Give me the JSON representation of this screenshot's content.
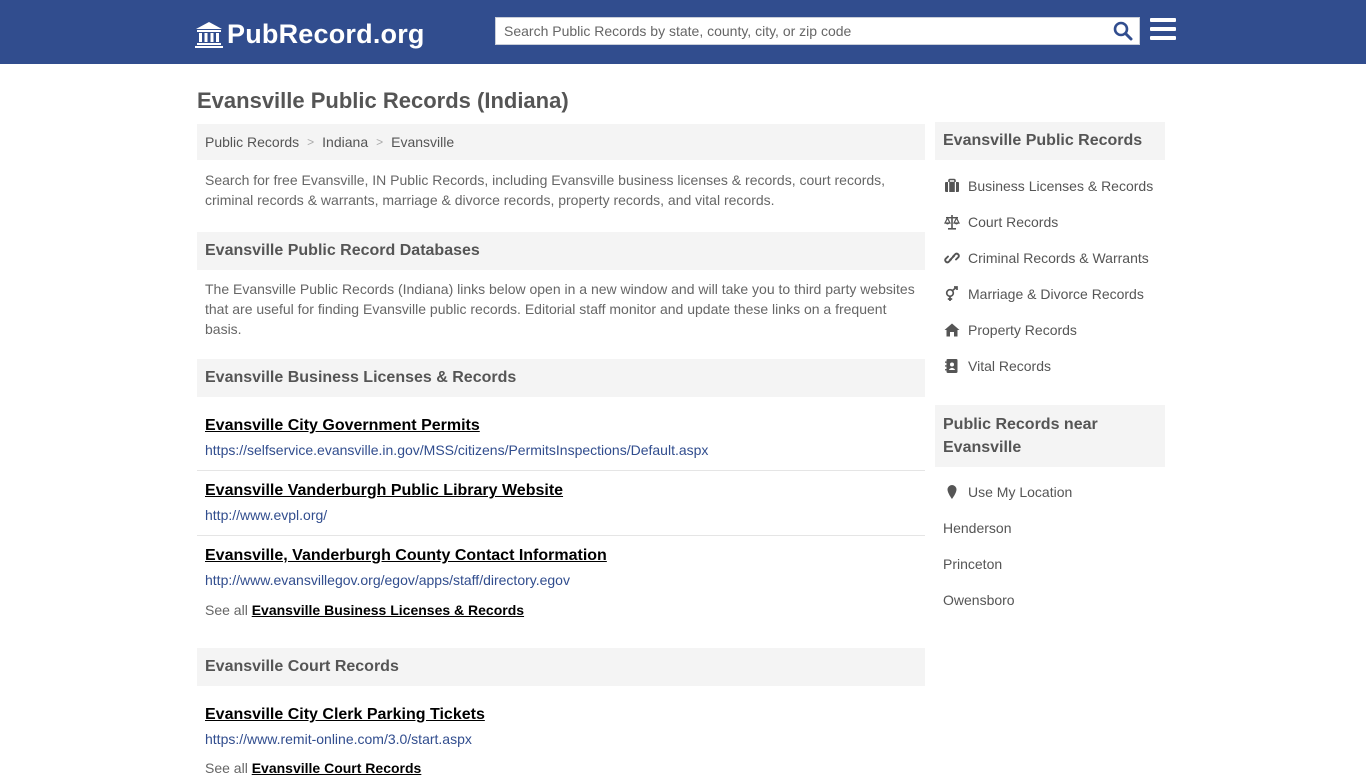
{
  "header": {
    "logo_text": "PubRecord.org",
    "search_placeholder": "Search Public Records by state, county, city, or zip code"
  },
  "page": {
    "title": "Evansville Public Records (Indiana)",
    "breadcrumb": [
      "Public Records",
      "Indiana",
      "Evansville"
    ],
    "intro": "Search for free Evansville, IN Public Records, including Evansville business licenses & records, court records, criminal records & warrants, marriage & divorce records, property records, and vital records."
  },
  "databases": {
    "heading": "Evansville Public Record Databases",
    "text": "The Evansville Public Records (Indiana) links below open in a new window and will take you to third party websites that are useful for finding Evansville public records. Editorial staff monitor and update these links on a frequent basis."
  },
  "business": {
    "heading": "Evansville Business Licenses & Records",
    "records": [
      {
        "title": "Evansville City Government Permits",
        "url": "https://selfservice.evansville.in.gov/MSS/citizens/PermitsInspections/Default.aspx"
      },
      {
        "title": "Evansville Vanderburgh Public Library Website",
        "url": "http://www.evpl.org/"
      },
      {
        "title": "Evansville, Vanderburgh County Contact Information",
        "url": "http://www.evansvillegov.org/egov/apps/staff/directory.egov"
      }
    ],
    "see_all_prefix": "See all",
    "see_all_link": "Evansville Business Licenses & Records"
  },
  "court": {
    "heading": "Evansville Court Records",
    "records": [
      {
        "title": "Evansville City Clerk Parking Tickets",
        "url": "https://www.remit-online.com/3.0/start.aspx"
      }
    ],
    "see_all_prefix": "See all",
    "see_all_link": "Evansville Court Records"
  },
  "sidebar": {
    "heading": "Evansville Public Records",
    "items": [
      {
        "label": "Business Licenses & Records",
        "icon": "briefcase-icon"
      },
      {
        "label": "Court Records",
        "icon": "scale-icon"
      },
      {
        "label": "Criminal Records & Warrants",
        "icon": "link-icon"
      },
      {
        "label": "Marriage & Divorce Records",
        "icon": "gender-icon"
      },
      {
        "label": "Property Records",
        "icon": "home-icon"
      },
      {
        "label": "Vital Records",
        "icon": "address-book-icon"
      }
    ],
    "near_heading": "Public Records near Evansville",
    "use_location": "Use My Location",
    "near_cities": [
      "Henderson",
      "Princeton",
      "Owensboro"
    ]
  },
  "colors": {
    "header_bg": "#314d8e",
    "link_url": "#314d8e",
    "panel_bg": "#f4f4f4"
  }
}
